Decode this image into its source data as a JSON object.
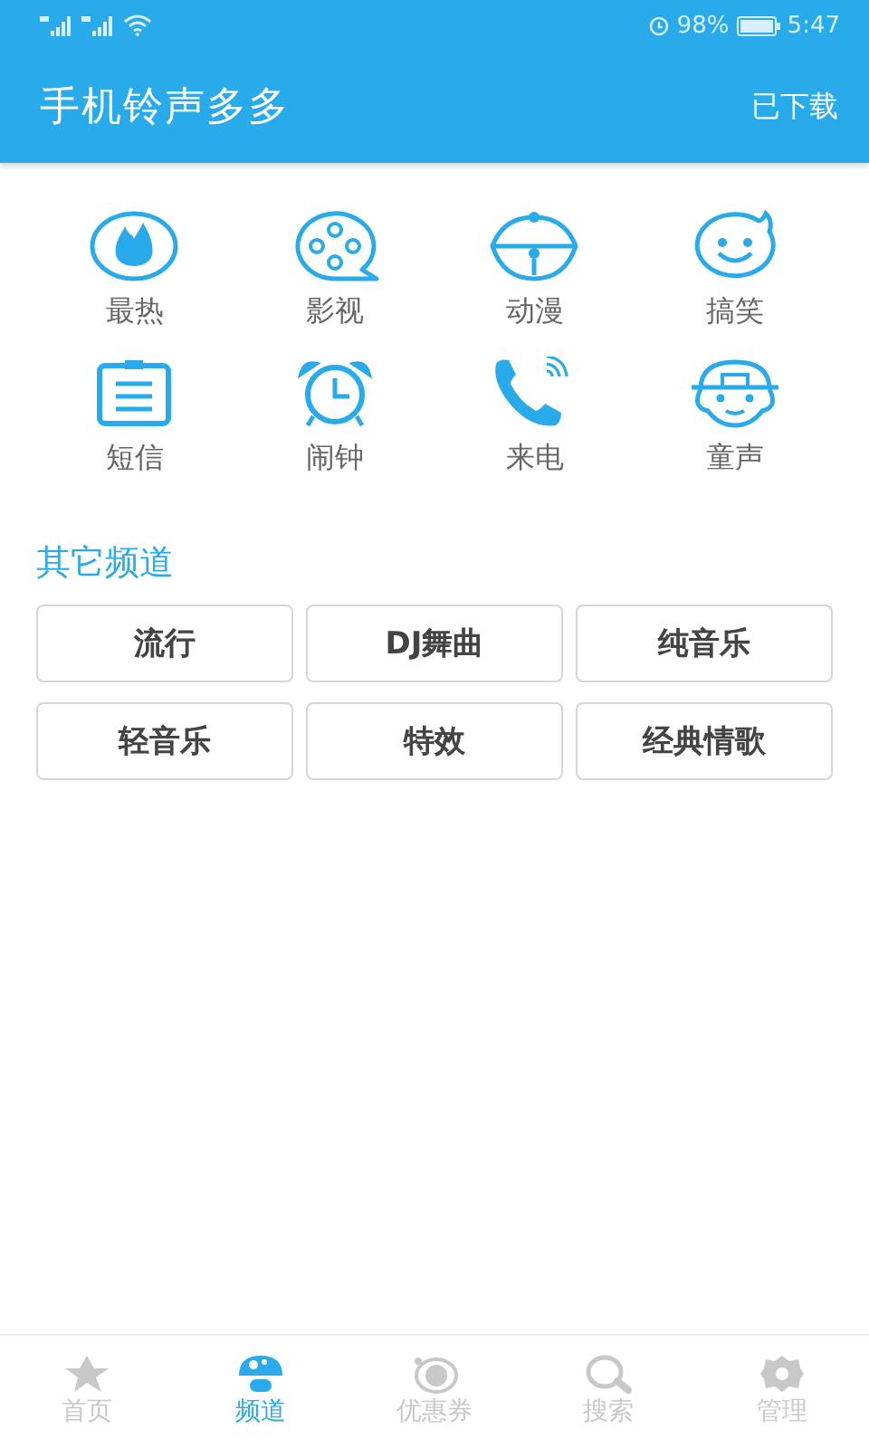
{
  "status_bar": {
    "battery_text": "98%",
    "time": "5:47"
  },
  "header": {
    "title": "手机铃声多多",
    "action": "已下载"
  },
  "categories": [
    {
      "kind": "fire",
      "label": "最热"
    },
    {
      "kind": "film",
      "label": "影视"
    },
    {
      "kind": "bell",
      "label": "动漫"
    },
    {
      "kind": "smile",
      "label": "搞笑"
    },
    {
      "kind": "message",
      "label": "短信"
    },
    {
      "kind": "alarm",
      "label": "闹钟"
    },
    {
      "kind": "phone",
      "label": "来电"
    },
    {
      "kind": "kid",
      "label": "童声"
    }
  ],
  "other_channels": {
    "title": "其它频道",
    "items": [
      "流行",
      "DJ舞曲",
      "纯音乐",
      "轻音乐",
      "特效",
      "经典情歌"
    ]
  },
  "tabs": [
    {
      "kind": "home",
      "label": "首页",
      "selected": false
    },
    {
      "kind": "channel",
      "label": "频道",
      "selected": true
    },
    {
      "kind": "coupon",
      "label": "优惠券",
      "selected": false
    },
    {
      "kind": "search",
      "label": "搜索",
      "selected": false
    },
    {
      "kind": "settings",
      "label": "管理",
      "selected": false
    }
  ]
}
